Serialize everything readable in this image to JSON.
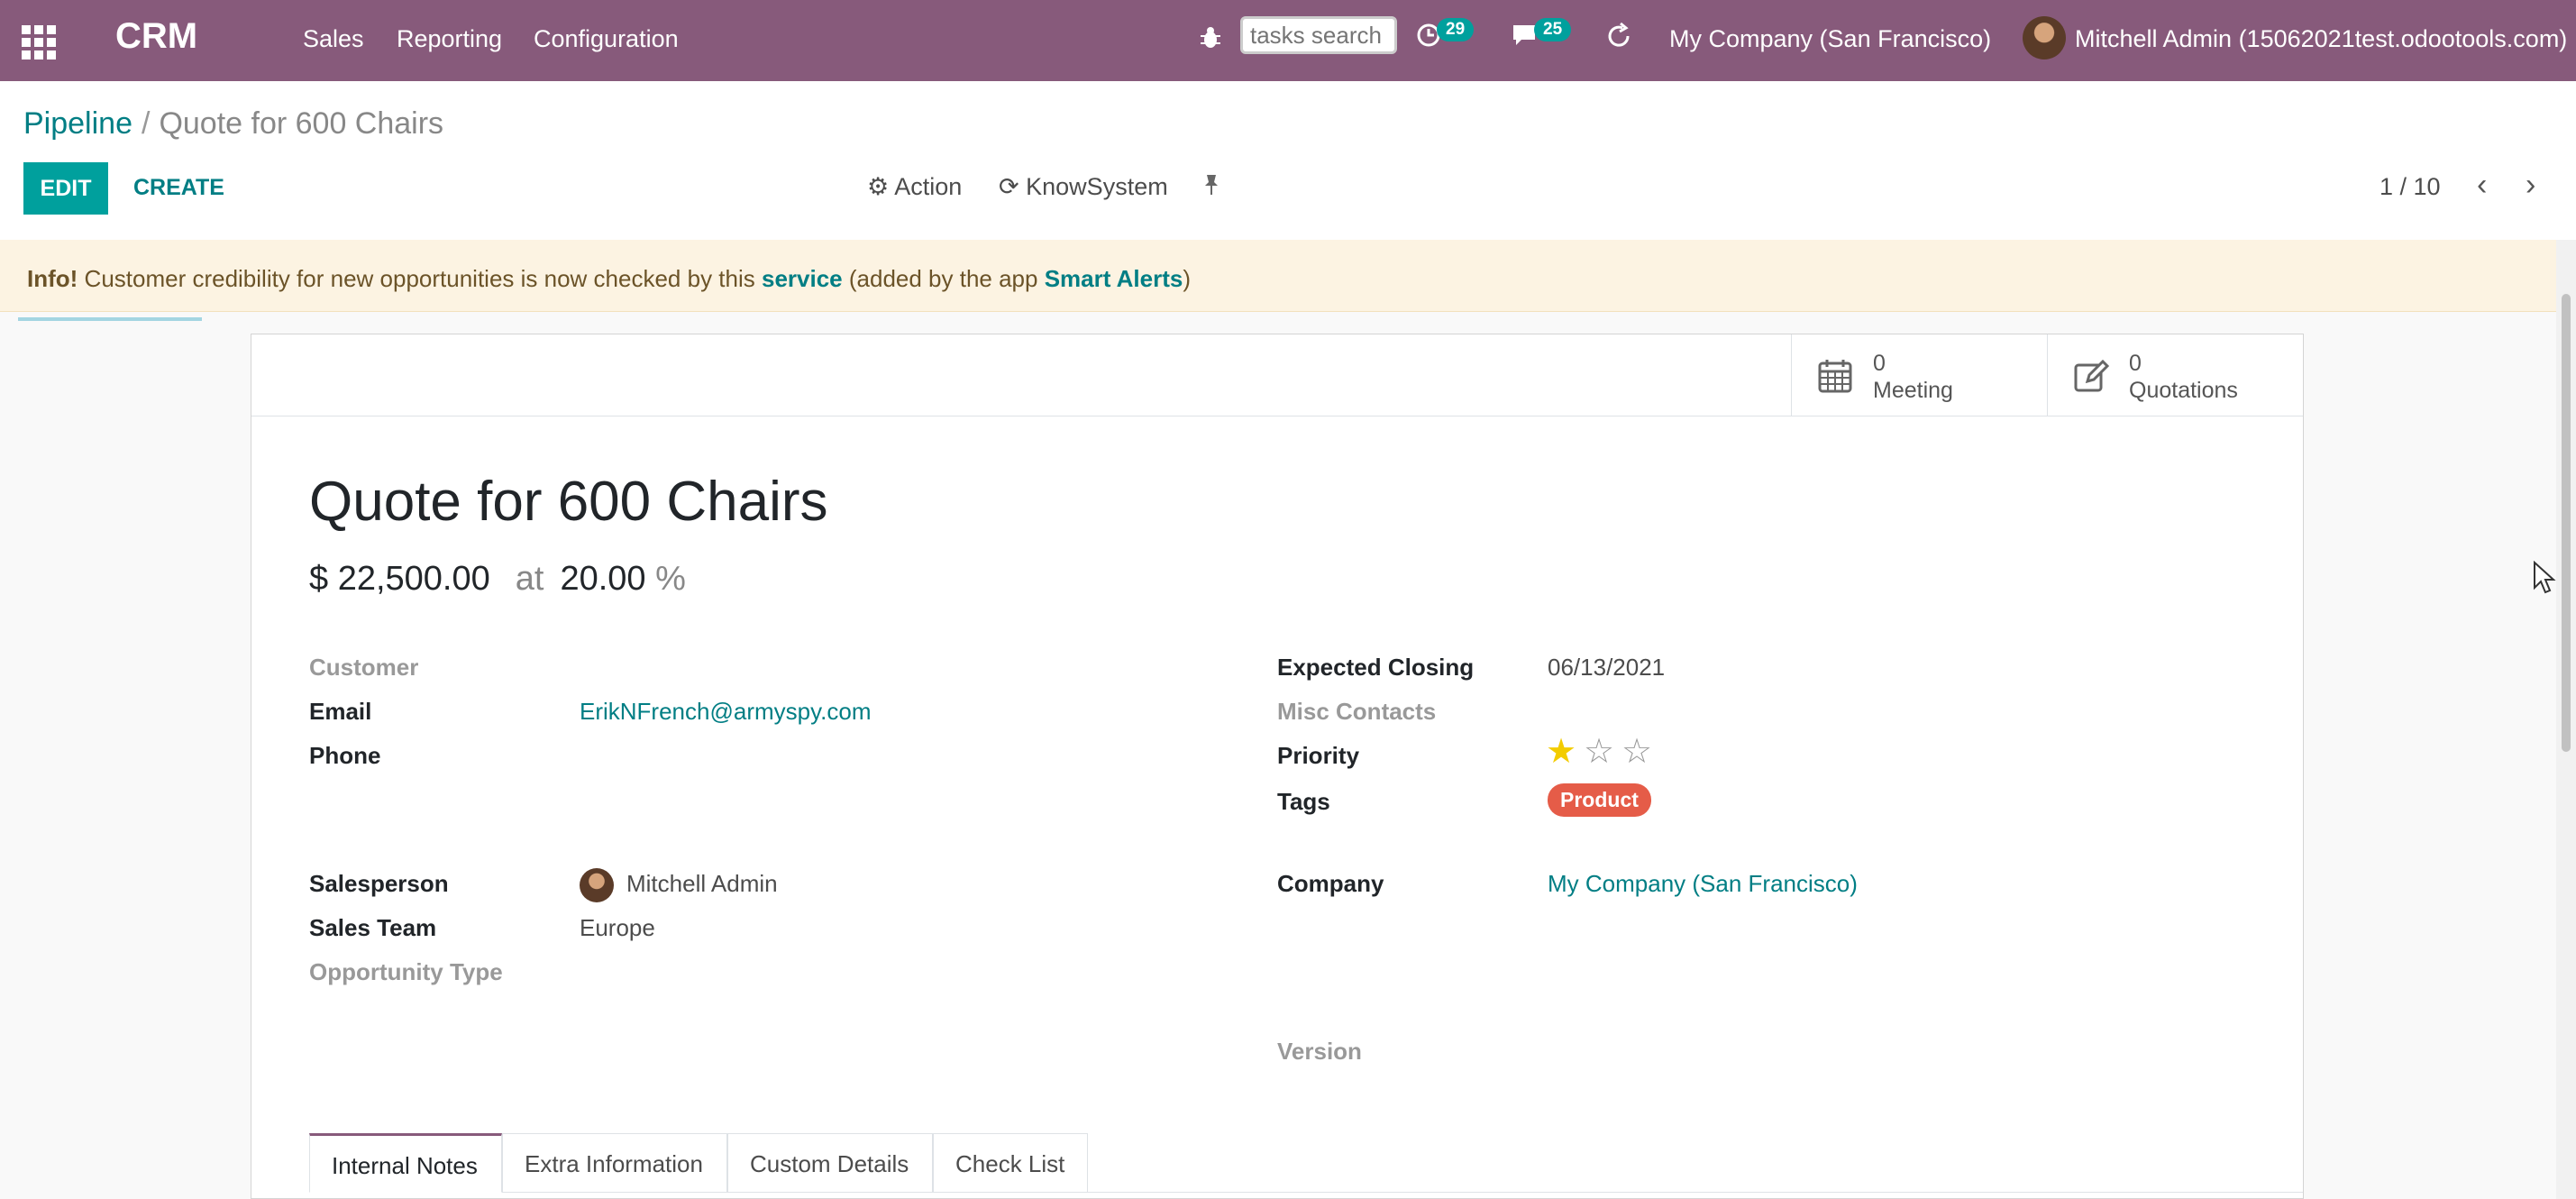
{
  "nav": {
    "app_name": "CRM",
    "menus": [
      "Sales",
      "Reporting",
      "Configuration"
    ],
    "search_placeholder": "tasks search",
    "activity_count": "29",
    "messages_count": "25",
    "company": "My Company (San Francisco)",
    "user": "Mitchell Admin (15062021test.odootools.com)",
    "icons": {
      "apps": "apps-grid-icon",
      "bug": "bug-icon",
      "activity": "clock-icon",
      "messages": "chat-icon",
      "refresh": "refresh-icon"
    }
  },
  "control": {
    "breadcrumb_root": "Pipeline",
    "breadcrumb_sep": "/",
    "breadcrumb_current": "Quote for 600 Chairs",
    "edit_label": "EDIT",
    "create_label": "CREATE",
    "action_label": "Action",
    "knowsystem_label": "KnowSystem",
    "pager": "1 / 10"
  },
  "alert": {
    "prefix": "Info!",
    "text1": " Customer credibility for new opportunities is now checked by this ",
    "link1": "service",
    "text2": " (added by the app ",
    "link2": "Smart Alerts",
    "text3": ")"
  },
  "smart_buttons": {
    "meeting": {
      "value": "0",
      "label": "Meeting"
    },
    "quotations": {
      "value": "0",
      "label": "Quotations"
    }
  },
  "form": {
    "title": "Quote for 600 Chairs",
    "revenue": "$ 22,500.00",
    "at": "at",
    "probability": "20.00",
    "percent": "%",
    "left": {
      "customer_label": "Customer",
      "email_label": "Email",
      "email_value": "ErikNFrench@armyspy.com",
      "phone_label": "Phone",
      "salesperson_label": "Salesperson",
      "salesperson_value": "Mitchell Admin",
      "sales_team_label": "Sales Team",
      "sales_team_value": "Europe",
      "opportunity_type_label": "Opportunity Type"
    },
    "right": {
      "expected_closing_label": "Expected Closing",
      "expected_closing_value": "06/13/2021",
      "misc_contacts_label": "Misc Contacts",
      "priority_label": "Priority",
      "priority_stars": 1,
      "priority_max": 3,
      "tags_label": "Tags",
      "tag_value": "Product",
      "company_label": "Company",
      "company_value": "My Company (San Francisco)",
      "version_label": "Version"
    },
    "tabs": [
      "Internal Notes",
      "Extra Information",
      "Custom Details",
      "Check List"
    ],
    "active_tab": "Internal Notes"
  },
  "colors": {
    "brand": "#875a7b",
    "accent": "#00a09d",
    "link": "#017e84",
    "tag": "#e55c48",
    "star": "#f3cc00"
  }
}
